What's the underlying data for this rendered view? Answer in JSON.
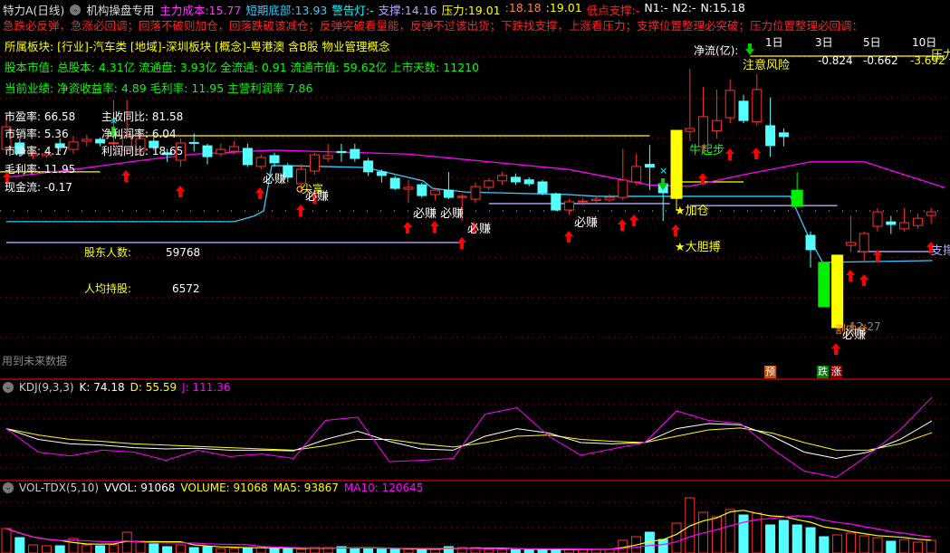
{
  "header": {
    "title": "特力A(日线)",
    "indicator_name": "机构操盘专用",
    "items": [
      {
        "label": "主力成本:",
        "value": "15.77",
        "color": "#ff33ff"
      },
      {
        "label": "短期底部:",
        "value": "13.93",
        "color": "#33ccff"
      },
      {
        "label": "警告灯:",
        "value": "-",
        "color": "#00ffff"
      },
      {
        "label": "支撑:",
        "value": "14.16",
        "color": "#b8a8ff"
      },
      {
        "label": "压力:",
        "value": "19.01",
        "color": "#ffff00"
      },
      {
        "label": ":",
        "value": "18.18",
        "color": "#ff8040"
      },
      {
        "label": ":",
        "value": "19.01",
        "color": "#ffff00"
      },
      {
        "label": "低点支撑:",
        "value": "-",
        "color": "#ff2020"
      },
      {
        "label": "N1:",
        "value": "-",
        "color": "#ffffff"
      },
      {
        "label": "N2:",
        "value": "-",
        "color": "#ffffff"
      },
      {
        "label": "N:",
        "value": "15.18",
        "color": "#ffffff"
      }
    ]
  },
  "tips": "急跌必反弹，急涨必回调；回落不破则加仓，回落跌破该减仓；反弹突破看量能，反弹不过该出货；下跌找支撑，上涨看压力；支撑位置整理必突破；压力位置整理必回调：",
  "sector": "所属板块: [行业]-汽车类 [地域]-深圳板块 [概念]-粤港澳 含B股 物业管理概念",
  "capital": "股本市值: 总股本: 4.31亿 流通盘: 3.93亿 全流通: 0.91 流通市值: 59.62亿 上市天数: 11210",
  "performance": "当前业绩: 净资收益率: 4.89 毛利率: 11.95 主营利润率 7.86",
  "fundamentals": {
    "pe": "市盈率: 66.58",
    "ps": "市销率: 5.36",
    "pb": "市净率: 4.17",
    "gross": "毛利率: 11.95",
    "cash": "现金流: -0.17",
    "rev_yoy": "主收同比: 81.58",
    "net_margin": "净利润率: 6.04",
    "profit_yoy": "利润同比: 18.65"
  },
  "holders": {
    "count_label": "股东人数:",
    "count": "59768",
    "avg_label": "人均持股:",
    "avg": "6572"
  },
  "netflow": {
    "label": "净流(亿):",
    "periods": [
      "1日",
      "3日",
      "5日",
      "10日"
    ],
    "values": [
      "-0.824",
      "-0.662",
      "-3.692"
    ]
  },
  "annotations": {
    "bizhuan": "必赚",
    "jianfu": "尖富",
    "niuqibu": "牛起步",
    "jiacang": "★加仓",
    "dadanbo": "★大胆搏",
    "risk": "注意风险",
    "gerou": "割肉仓",
    "time": "12:27",
    "support": "支撑",
    "pressure": "压力",
    "yu": "预",
    "die": "跌",
    "zhang": "涨",
    "future": "用到未来数据"
  },
  "kdj_header": {
    "name": "KDJ(9,3,3)",
    "k": "K: 74.18",
    "d": "D: 55.59",
    "j": "J: 111.36"
  },
  "vol_header": {
    "name": "VOL-TDX(5,10)",
    "vvol": "VVOL: 91068",
    "volume": "VOLUME: 91068",
    "ma5": "MA5: 93867",
    "ma10": "MA10: 120645"
  },
  "colors": {
    "up": "#ff3030",
    "down": "#55ffff",
    "ma": "#ff00ff",
    "line": "#33ccff",
    "press": "#ffff00",
    "support": "#b8a8ff",
    "grid": "#a00000"
  },
  "chart_data": {
    "type": "candlestick",
    "title": "特力A(日线)",
    "candles": [
      [
        18.48,
        19.36,
        19.9,
        18.3
      ],
      [
        18.73,
        18.31,
        18.9,
        18.2
      ],
      [
        18.24,
        18.31,
        18.5,
        18.1
      ],
      [
        18.24,
        18.31,
        18.45,
        18.15
      ],
      [
        18.7,
        18.55,
        18.9,
        18.4
      ],
      [
        18.48,
        18.77,
        19.0,
        18.3
      ],
      [
        18.8,
        18.87,
        19.05,
        18.6
      ],
      [
        18.87,
        18.73,
        18.95,
        18.6
      ],
      [
        18.72,
        18.74,
        20.4,
        18.4
      ],
      [
        18.45,
        19.01,
        20.4,
        18.3
      ],
      [
        18.41,
        18.9,
        19.2,
        18.2
      ],
      [
        18.8,
        18.55,
        18.95,
        18.45
      ],
      [
        18.35,
        18.28,
        18.5,
        18.0
      ],
      [
        18.06,
        18.73,
        18.9,
        17.8
      ],
      [
        18.75,
        18.72,
        19.1,
        18.4
      ],
      [
        18.62,
        18.2,
        18.7,
        17.9
      ],
      [
        18.31,
        18.48,
        18.7,
        18.2
      ],
      [
        18.41,
        18.59,
        18.8,
        18.3
      ],
      [
        18.52,
        17.89,
        18.7,
        17.8
      ],
      [
        17.82,
        18.17,
        18.3,
        17.7
      ],
      [
        18.24,
        17.96,
        18.35,
        17.8
      ],
      [
        17.85,
        17.4,
        17.95,
        17.2
      ],
      [
        17.15,
        17.71,
        17.9,
        16.8
      ],
      [
        17.64,
        18.27,
        18.35,
        17.5
      ],
      [
        18.13,
        18.24,
        18.7,
        18.0
      ],
      [
        18.4,
        18.36,
        18.7,
        18.0
      ],
      [
        18.48,
        18.13,
        18.7,
        18.0
      ],
      [
        18.03,
        17.61,
        18.15,
        17.45
      ],
      [
        17.61,
        17.47,
        17.7,
        17.2
      ],
      [
        17.36,
        16.97,
        17.45,
        16.9
      ],
      [
        16.94,
        17.01,
        17.3,
        16.4
      ],
      [
        17.11,
        16.69,
        17.2,
        16.6
      ],
      [
        16.73,
        16.9,
        17.0,
        16.5
      ],
      [
        16.9,
        16.62,
        17.6,
        16.55
      ],
      [
        16.62,
        16.66,
        16.75,
        15.7
      ],
      [
        16.55,
        17.04,
        17.2,
        16.4
      ],
      [
        17.01,
        17.26,
        17.35,
        16.9
      ],
      [
        17.26,
        17.47,
        17.6,
        17.1
      ],
      [
        17.4,
        17.22,
        17.55,
        17.1
      ],
      [
        17.3,
        17.15,
        17.4,
        17.05
      ],
      [
        17.22,
        16.8,
        17.3,
        16.7
      ],
      [
        16.76,
        16.13,
        16.8,
        16.1
      ],
      [
        16.13,
        16.45,
        16.55,
        15.95
      ],
      [
        16.45,
        16.48,
        16.6,
        16.3
      ],
      [
        16.5,
        16.55,
        16.7,
        16.4
      ],
      [
        16.52,
        16.62,
        16.75,
        16.45
      ],
      [
        16.62,
        17.29,
        18.5,
        16.5
      ],
      [
        17.22,
        17.82,
        18.3,
        17.1
      ],
      [
        17.9,
        17.8,
        18.65,
        16.9
      ],
      [
        17.15,
        16.8,
        17.2,
        15.7
      ],
      [
        16.58,
        19.22,
        19.22,
        16.1,
        "yellow"
      ],
      [
        19.18,
        19.29,
        21.6,
        18.8
      ],
      [
        18.59,
        19.75,
        20.9,
        18.4
      ],
      [
        19.2,
        19.6,
        20.8,
        18.9
      ],
      [
        19.71,
        20.77,
        21.2,
        19.5
      ],
      [
        20.35,
        19.6,
        20.6,
        19.5
      ],
      [
        19.55,
        20.8,
        21.4,
        19.4
      ],
      [
        19.4,
        18.63,
        20.5,
        18.2
      ],
      [
        19.12,
        18.98,
        19.3,
        18.6
      ],
      [
        16.9,
        16.27,
        17.6,
        16.27,
        "green"
      ],
      [
        15.15,
        14.59,
        15.3,
        13.9
      ],
      [
        14.1,
        12.38,
        14.1,
        12.38,
        "green"
      ],
      [
        11.57,
        14.38,
        14.38,
        11.57,
        "yellow"
      ],
      [
        14.76,
        14.87,
        15.9,
        14.5
      ],
      [
        14.52,
        15.22,
        15.3,
        14.1
      ],
      [
        15.5,
        16.06,
        16.2,
        15.3
      ],
      [
        15.67,
        15.57,
        15.9,
        15.2
      ],
      [
        15.4,
        15.64,
        16.2,
        15.3
      ],
      [
        15.53,
        15.81,
        16.0,
        15.4
      ],
      [
        15.92,
        16.06,
        16.2,
        15.6
      ]
    ],
    "ma_line": [
      [
        0,
        17.4
      ],
      [
        5,
        17.7
      ],
      [
        10,
        18.05
      ],
      [
        14,
        18.3
      ],
      [
        20,
        18.45
      ],
      [
        30,
        18.3
      ],
      [
        36,
        18.0
      ],
      [
        42,
        17.7
      ],
      [
        48,
        17.1
      ],
      [
        51,
        17.05
      ],
      [
        55,
        17.5
      ],
      [
        60,
        18.0
      ],
      [
        64,
        18.0
      ],
      [
        70,
        17.0
      ]
    ],
    "cost_line": [
      [
        0,
        15.68
      ],
      [
        17,
        15.68
      ],
      [
        18.5,
        15.9
      ],
      [
        19.2,
        16.1
      ],
      [
        19.8,
        17.85
      ],
      [
        21,
        17.85
      ],
      [
        26.8,
        17.78
      ],
      [
        28.8,
        17.54
      ],
      [
        31.1,
        17.26
      ],
      [
        31.8,
        16.97
      ],
      [
        34.2,
        16.83
      ],
      [
        41.9,
        16.73
      ],
      [
        44.1,
        16.66
      ],
      [
        58.5,
        16.66
      ],
      [
        59.8,
        15.15
      ],
      [
        60.9,
        14.1
      ],
      [
        69.1,
        14.17
      ]
    ],
    "pressure_segments": [
      [
        [
          -0.5,
          17.61
        ],
        [
          7,
          17.61
        ]
      ],
      [
        [
          7.6,
          19.01
        ],
        [
          48,
          19.01
        ]
      ],
      [
        [
          50,
          17.22
        ],
        [
          55,
          17.22
        ]
      ],
      [
        [
          55.5,
          22.1
        ],
        [
          70,
          22.1
        ]
      ]
    ],
    "support_segments": [
      [
        [
          0,
          14.87
        ],
        [
          34,
          14.87
        ]
      ],
      [
        [
          36,
          16.38
        ],
        [
          49.5,
          16.38
        ]
      ],
      [
        [
          51,
          16.3
        ],
        [
          62,
          16.3
        ]
      ],
      [
        [
          63.5,
          14.52
        ],
        [
          69.3,
          14.52
        ]
      ]
    ],
    "kdj": {
      "k": [
        62,
        45,
        38,
        36,
        32,
        30,
        31,
        28,
        28,
        27,
        45,
        58,
        42,
        30,
        28,
        50,
        62,
        55,
        40,
        38,
        40,
        62,
        70,
        68,
        50,
        25,
        15,
        25,
        45,
        74.18
      ],
      "d": [
        62,
        52,
        45,
        42,
        38,
        36,
        34,
        32,
        30,
        28,
        35,
        45,
        45,
        38,
        33,
        40,
        50,
        52,
        45,
        42,
        40,
        50,
        60,
        63,
        55,
        40,
        28,
        28,
        38,
        55.59
      ],
      "j": [
        62,
        25,
        19,
        28,
        25,
        12,
        28,
        18,
        22,
        15,
        75,
        80,
        10,
        12,
        15,
        85,
        95,
        50,
        20,
        30,
        40,
        90,
        75,
        70,
        30,
        -5,
        -15,
        20,
        60,
        111.36
      ]
    },
    "volume": [
      175500,
      110500,
      58500,
      52000,
      52000,
      104000,
      58500,
      52000,
      58500,
      149500,
      84500,
      65000,
      45500,
      58500,
      39000,
      45500,
      32500,
      32500,
      39000,
      39000,
      32500,
      32500,
      26000,
      39000,
      39000,
      45500,
      32500,
      32500,
      32500,
      26000,
      26000,
      26000,
      26000,
      45500,
      39000,
      39000,
      26000,
      26000,
      26000,
      26000,
      26000,
      26000,
      26000,
      26000,
      26000,
      26000,
      91000,
      117000,
      149500,
      97500,
      214500,
      396500,
      292500,
      260000,
      312000,
      273000,
      286000,
      201500,
      234000,
      201500,
      182000,
      117000,
      130000,
      143000,
      123500,
      110500,
      84500,
      97500,
      78000,
      91068
    ]
  }
}
